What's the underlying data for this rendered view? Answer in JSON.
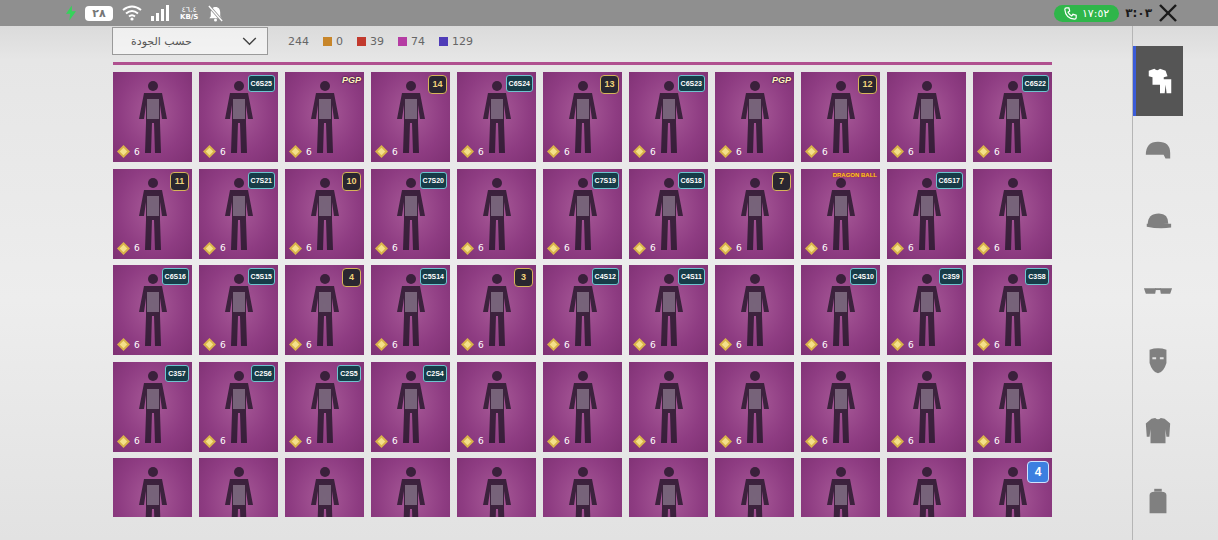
{
  "status_bar": {
    "battery": "٢٨",
    "speed": "٤٦.٤",
    "speed_unit": "KB/S",
    "silent": true,
    "call_time": "١٧:٥٢",
    "clock": "٣:٠٣"
  },
  "sort_dropdown": {
    "value": "حسب الجودة"
  },
  "total_count": "244",
  "rarity_counts": [
    {
      "count": "0",
      "color": "#c8862a"
    },
    {
      "count": "39",
      "color": "#c23a2e"
    },
    {
      "count": "74",
      "color": "#b53ca3"
    },
    {
      "count": "129",
      "color": "#4f3cb8"
    }
  ],
  "categories": [
    {
      "kind": "outfit",
      "selected": true
    },
    {
      "kind": "helmet",
      "selected": false
    },
    {
      "kind": "hat",
      "selected": false
    },
    {
      "kind": "glasses",
      "selected": false
    },
    {
      "kind": "mask",
      "selected": false
    },
    {
      "kind": "jacket",
      "selected": false
    },
    {
      "kind": "backpack",
      "selected": false
    }
  ],
  "items": [
    {
      "count": "6",
      "badge": null
    },
    {
      "count": "6",
      "badge": {
        "kind": "season",
        "text": "C6S25"
      }
    },
    {
      "count": "6",
      "badge": {
        "kind": "logo",
        "text": "PGP"
      }
    },
    {
      "count": "6",
      "badge": {
        "kind": "rank",
        "text": "14"
      }
    },
    {
      "count": "6",
      "badge": {
        "kind": "season",
        "text": "C6S24"
      }
    },
    {
      "count": "6",
      "badge": {
        "kind": "rank",
        "text": "13"
      }
    },
    {
      "count": "6",
      "badge": {
        "kind": "season",
        "text": "C6S23"
      }
    },
    {
      "count": "6",
      "badge": {
        "kind": "logo",
        "text": "PGP"
      }
    },
    {
      "count": "6",
      "badge": {
        "kind": "rank",
        "text": "12"
      }
    },
    {
      "count": "6",
      "badge": null
    },
    {
      "count": "6",
      "badge": {
        "kind": "season",
        "text": "C6S22"
      }
    },
    {
      "count": "6",
      "badge": {
        "kind": "rank",
        "text": "11"
      }
    },
    {
      "count": "6",
      "badge": {
        "kind": "season",
        "text": "C7S21"
      }
    },
    {
      "count": "6",
      "badge": {
        "kind": "rank",
        "text": "10"
      }
    },
    {
      "count": "6",
      "badge": {
        "kind": "season",
        "text": "C7S20"
      }
    },
    {
      "count": "6",
      "badge": null
    },
    {
      "count": "6",
      "badge": {
        "kind": "season",
        "text": "C7S19"
      }
    },
    {
      "count": "6",
      "badge": {
        "kind": "season",
        "text": "C6S18"
      }
    },
    {
      "count": "6",
      "badge": {
        "kind": "rank",
        "text": "7"
      }
    },
    {
      "count": "6",
      "badge": {
        "kind": "brand",
        "text": "DRAGON BALL"
      }
    },
    {
      "count": "6",
      "badge": {
        "kind": "season",
        "text": "C6S17"
      }
    },
    {
      "count": "6",
      "badge": null
    },
    {
      "count": "6",
      "badge": {
        "kind": "season",
        "text": "C6S16"
      }
    },
    {
      "count": "6",
      "badge": {
        "kind": "season",
        "text": "C5S15"
      }
    },
    {
      "count": "6",
      "badge": {
        "kind": "rank",
        "text": "4"
      }
    },
    {
      "count": "6",
      "badge": {
        "kind": "season",
        "text": "C5S14"
      }
    },
    {
      "count": "6",
      "badge": {
        "kind": "rank",
        "text": "3"
      }
    },
    {
      "count": "6",
      "badge": {
        "kind": "season",
        "text": "C4S12"
      }
    },
    {
      "count": "6",
      "badge": {
        "kind": "season",
        "text": "C4S11"
      }
    },
    {
      "count": "6",
      "badge": null
    },
    {
      "count": "6",
      "badge": {
        "kind": "season",
        "text": "C4S10"
      }
    },
    {
      "count": "6",
      "badge": {
        "kind": "season",
        "text": "C3S9"
      }
    },
    {
      "count": "6",
      "badge": {
        "kind": "season",
        "text": "C3S8"
      }
    },
    {
      "count": "6",
      "badge": {
        "kind": "season",
        "text": "C3S7"
      }
    },
    {
      "count": "6",
      "badge": {
        "kind": "season",
        "text": "C2S6"
      }
    },
    {
      "count": "6",
      "badge": {
        "kind": "season",
        "text": "C2S5"
      }
    },
    {
      "count": "6",
      "badge": {
        "kind": "season",
        "text": "C2S4"
      }
    },
    {
      "count": "6",
      "badge": null
    },
    {
      "count": "6",
      "badge": null
    },
    {
      "count": "6",
      "badge": null
    },
    {
      "count": "6",
      "badge": null
    },
    {
      "count": "6",
      "badge": null
    },
    {
      "count": "6",
      "badge": null
    },
    {
      "count": "6",
      "badge": null
    },
    {
      "count": null,
      "badge": null
    },
    {
      "count": null,
      "badge": null
    },
    {
      "count": null,
      "badge": null
    },
    {
      "count": null,
      "badge": null
    },
    {
      "count": null,
      "badge": null
    },
    {
      "count": null,
      "badge": null
    },
    {
      "count": null,
      "badge": null
    },
    {
      "count": null,
      "badge": null
    },
    {
      "count": null,
      "badge": null
    },
    {
      "count": null,
      "badge": null
    },
    {
      "count": null,
      "badge": {
        "kind": "level",
        "text": "4"
      }
    }
  ]
}
